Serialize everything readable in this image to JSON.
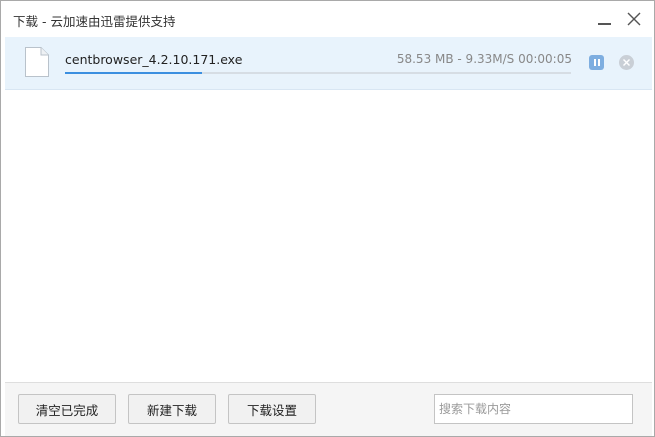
{
  "window": {
    "title": "下载 - 云加速由迅雷提供支持"
  },
  "downloads": [
    {
      "file_name": "centbrowser_4.2.10.171.exe",
      "size": "58.53 MB",
      "speed": "9.33M/S",
      "time_remaining": "00:00:05",
      "stats_text": "58.53 MB - 9.33M/S 00:00:05",
      "progress": 0.27,
      "icon": "file-icon"
    }
  ],
  "footer": {
    "clear_label": "清空已完成",
    "new_label": "新建下载",
    "settings_label": "下载设置",
    "search_placeholder": "搜索下载内容"
  },
  "colors": {
    "item_background": "#e8f3fc",
    "progress": "#3b8fe0",
    "pause_button": "#7eaee0"
  }
}
